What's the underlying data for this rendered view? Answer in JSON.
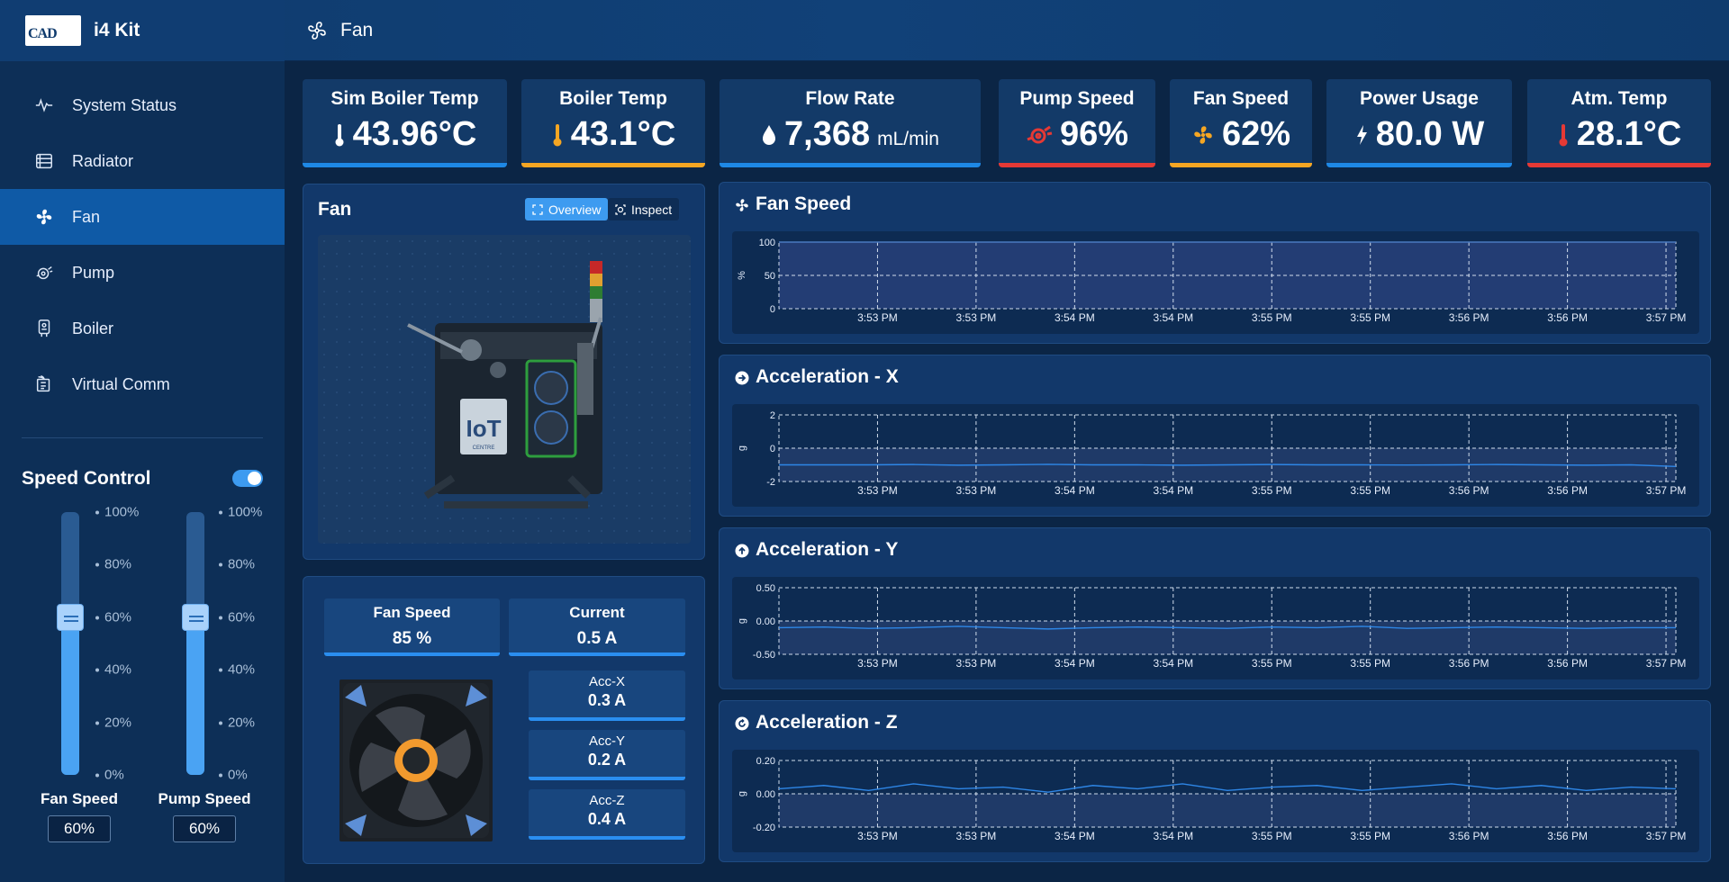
{
  "app": {
    "brand_logo_text": "CAD",
    "name": "i4 Kit",
    "page_title": "Fan"
  },
  "nav": [
    {
      "label": "System Status",
      "icon": "pulse-icon"
    },
    {
      "label": "Radiator",
      "icon": "radiator-icon"
    },
    {
      "label": "Fan",
      "icon": "fan-icon",
      "active": true
    },
    {
      "label": "Pump",
      "icon": "pump-icon"
    },
    {
      "label": "Boiler",
      "icon": "boiler-icon"
    },
    {
      "label": "Virtual Comm",
      "icon": "comm-icon"
    }
  ],
  "speed_control": {
    "title": "Speed Control",
    "enabled": true,
    "ticks": [
      "100%",
      "80%",
      "60%",
      "40%",
      "20%",
      "0%"
    ],
    "fan": {
      "label": "Fan Speed",
      "value": "60%",
      "level": 0.6
    },
    "pump": {
      "label": "Pump Speed",
      "value": "60%",
      "level": 0.6
    }
  },
  "kpis": [
    {
      "title": "Sim Boiler Temp",
      "value": "43.96°C",
      "unit": "",
      "icon": "thermometer-icon",
      "color": "#1e88e5"
    },
    {
      "title": "Boiler Temp",
      "value": "43.1°C",
      "unit": "",
      "icon": "thermometer-icon",
      "color": "#f5a623"
    },
    {
      "title": "Flow Rate",
      "value": "7,368",
      "unit": "mL/min",
      "icon": "droplet-icon",
      "color": "#1e88e5"
    },
    {
      "title": "Pump Speed",
      "value": "96%",
      "unit": "",
      "icon": "pump-icon",
      "color": "#e53935"
    },
    {
      "title": "Fan Speed",
      "value": "62%",
      "unit": "",
      "icon": "fan-icon",
      "color": "#f5a623"
    },
    {
      "title": "Power Usage",
      "value": "80.0 W",
      "unit": "",
      "icon": "bolt-icon",
      "color": "#1e88e5"
    },
    {
      "title": "Atm. Temp",
      "value": "28.1°C",
      "unit": "",
      "icon": "thermometer-icon",
      "color": "#e53935"
    }
  ],
  "fan_panel": {
    "title": "Fan",
    "overview_label": "Overview",
    "inspect_label": "Inspect",
    "logo_text": "IoT",
    "logo_subtext": "CENTRE"
  },
  "metrics": {
    "fan_speed": {
      "label": "Fan Speed",
      "value": "85 %"
    },
    "current": {
      "label": "Current",
      "value": "0.5 A"
    },
    "acc": [
      {
        "label": "Acc-X",
        "value": "0.3 A"
      },
      {
        "label": "Acc-Y",
        "value": "0.2 A"
      },
      {
        "label": "Acc-Z",
        "value": "0.4 A"
      }
    ]
  },
  "colors": {
    "accent": "#2a8ef0",
    "chart_line": "#2e86e6",
    "grid": "#d0dcec"
  },
  "chart_data": [
    {
      "type": "area",
      "title": "Fan Speed",
      "icon": "fan-icon",
      "ylabel": "%",
      "ylim": [
        0,
        100
      ],
      "yticks": [
        "100",
        "50",
        "0"
      ],
      "xticks": [
        "3:53 PM",
        "3:53 PM",
        "3:54 PM",
        "3:54 PM",
        "3:55 PM",
        "3:55 PM",
        "3:56 PM",
        "3:56 PM",
        "3:57 PM"
      ],
      "series": [
        {
          "values": [
            100,
            100,
            100,
            100,
            100,
            100,
            100,
            100,
            100,
            100,
            100
          ]
        }
      ]
    },
    {
      "type": "line",
      "title": "Acceleration - X",
      "icon": "arrow-right-circle-icon",
      "ylabel": "g",
      "ylim": [
        -2,
        2
      ],
      "yticks": [
        "2",
        "0",
        "-2"
      ],
      "xticks": [
        "3:53 PM",
        "3:53 PM",
        "3:54 PM",
        "3:54 PM",
        "3:55 PM",
        "3:55 PM",
        "3:56 PM",
        "3:56 PM",
        "3:57 PM"
      ],
      "series": [
        {
          "values": [
            -1.0,
            -1.0,
            -1.0,
            -0.98,
            -1.02,
            -1.0,
            -0.97,
            -1.0,
            -1.0,
            -1.02,
            -1.0,
            -0.98,
            -1.0,
            -1.0,
            -1.01,
            -1.0,
            -0.98,
            -1.0,
            -1.02,
            -1.0,
            -1.1
          ]
        }
      ]
    },
    {
      "type": "line",
      "title": "Acceleration - Y",
      "icon": "arrow-up-circle-icon",
      "ylabel": "g",
      "ylim": [
        -0.5,
        0.5
      ],
      "yticks": [
        "0.50",
        "0.00",
        "-0.50"
      ],
      "xticks": [
        "3:53 PM",
        "3:53 PM",
        "3:54 PM",
        "3:54 PM",
        "3:55 PM",
        "3:55 PM",
        "3:56 PM",
        "3:56 PM",
        "3:57 PM"
      ],
      "series": [
        {
          "values": [
            -0.1,
            -0.09,
            -0.11,
            -0.1,
            -0.08,
            -0.1,
            -0.12,
            -0.1,
            -0.09,
            -0.1,
            -0.11,
            -0.09,
            -0.1,
            -0.08,
            -0.11,
            -0.1,
            -0.09,
            -0.1,
            -0.11,
            -0.1,
            -0.1
          ]
        }
      ]
    },
    {
      "type": "line",
      "title": "Acceleration - Z",
      "icon": "rotate-circle-icon",
      "ylabel": "g",
      "ylim": [
        -0.2,
        0.2
      ],
      "yticks": [
        "0.20",
        "0.00",
        "-0.20"
      ],
      "xticks": [
        "3:53 PM",
        "3:53 PM",
        "3:54 PM",
        "3:54 PM",
        "3:55 PM",
        "3:55 PM",
        "3:56 PM",
        "3:56 PM",
        "3:57 PM"
      ],
      "series": [
        {
          "values": [
            0.03,
            0.05,
            0.02,
            0.06,
            0.03,
            0.04,
            0.01,
            0.05,
            0.03,
            0.06,
            0.02,
            0.04,
            0.05,
            0.02,
            0.04,
            0.06,
            0.03,
            0.05,
            0.02,
            0.04,
            0.03
          ]
        }
      ]
    }
  ]
}
